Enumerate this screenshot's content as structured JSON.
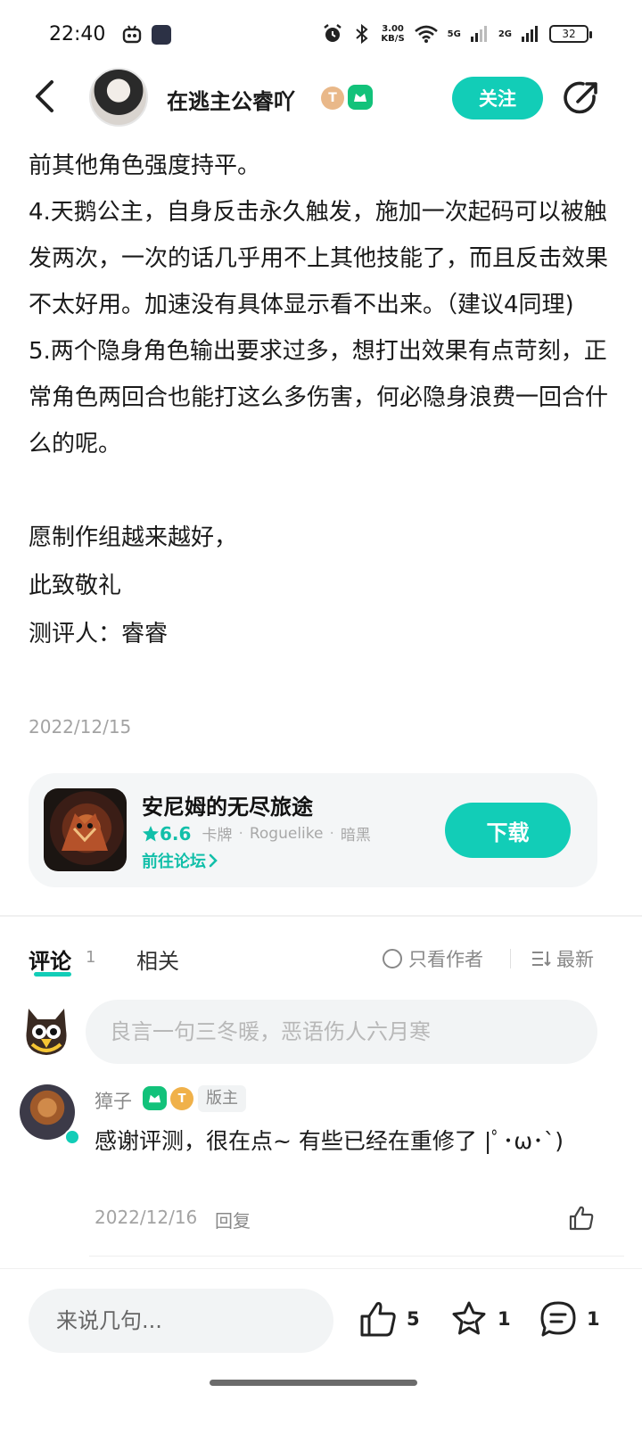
{
  "status_bar": {
    "time": "22:40",
    "speed_value": "3.00",
    "speed_unit": "KB/S",
    "net1": "5G",
    "net2": "2G",
    "battery": "32"
  },
  "header": {
    "author_name": "在逃主公睿吖",
    "badge_t": "T",
    "follow_label": "关注"
  },
  "article": {
    "paragraphs": [
      "前其他角色强度持平。",
      "4.天鹅公主，自身反击永久触发，施加一次起码可以被触发两次，一次的话几乎用不上其他技能了，而且反击效果不太好用。加速没有具体显示看不出来。（建议4同理)",
      "5.两个隐身角色输出要求过多，想打出效果有点苛刻，正常角色两回合也能打这么多伤害，何必隐身浪费一回合什么的呢。"
    ],
    "closing": [
      "愿制作组越来越好，",
      "此致敬礼",
      "测评人：睿睿"
    ],
    "date": "2022/12/15"
  },
  "game_card": {
    "title": "安尼姆的无尽旅途",
    "rating": "6.6",
    "tags": [
      "卡牌",
      "Roguelike",
      "暗黑"
    ],
    "forum_link": "前往论坛",
    "download_label": "下载"
  },
  "comments_section": {
    "tab_comment": "评论",
    "tab_count": "1",
    "tab_related": "相关",
    "filter_author": "只看作者",
    "sort_label": "最新",
    "input_placeholder": "良言一句三冬暖，恶语伤人六月寒"
  },
  "comment": {
    "user": "獐子",
    "badge_t": "T",
    "role": "版主",
    "text": "感谢评测，很在点~ 有些已经在重修了 |ﾟ･ω･`)",
    "date": "2022/12/16",
    "reply_label": "回复"
  },
  "bottom_bar": {
    "input_placeholder": "来说几句...",
    "likes": "5",
    "favorites": "1",
    "comments": "1"
  },
  "colors": {
    "accent": "#12cdb7",
    "green_badge": "#12c27a"
  }
}
